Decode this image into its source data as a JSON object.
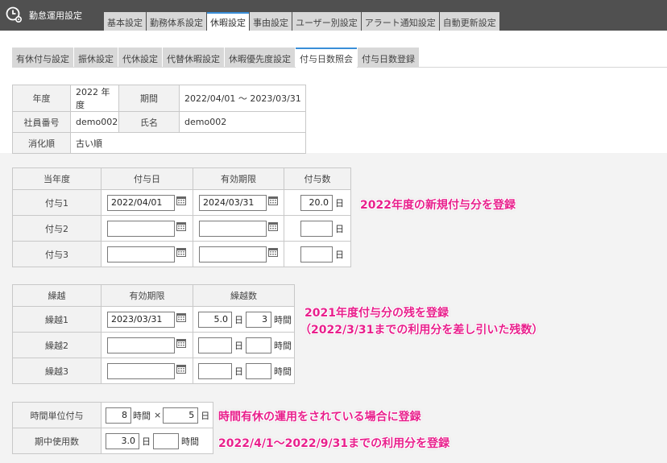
{
  "app": {
    "title": "勤怠運用設定",
    "icon": "clock-gear-icon"
  },
  "main_tabs": [
    "基本設定",
    "勤務体系設定",
    "休暇設定",
    "事由設定",
    "ユーザー別設定",
    "アラート通知設定",
    "自動更新設定"
  ],
  "main_tab_active": 2,
  "sub_tabs": [
    "有休付与設定",
    "振休設定",
    "代休設定",
    "代替休暇設定",
    "休暇優先度設定",
    "付与日数照会",
    "付与日数登録"
  ],
  "sub_tab_active": 5,
  "info": {
    "year_label": "年度",
    "year_value": "2022 年度",
    "period_label": "期間",
    "period_value": "2022/04/01 ～ 2023/03/31",
    "empno_label": "社員番号",
    "empno_value": "demo002",
    "name_label": "氏名",
    "name_value": "demo002",
    "order_label": "消化順",
    "order_value": "古い順"
  },
  "grant": {
    "headers": [
      "当年度",
      "付与日",
      "有効期限",
      "付与数"
    ],
    "unit": "日",
    "rows": [
      {
        "label": "付与1",
        "date": "2022/04/01",
        "expiry": "2024/03/31",
        "count": "20.0"
      },
      {
        "label": "付与2",
        "date": "",
        "expiry": "",
        "count": ""
      },
      {
        "label": "付与3",
        "date": "",
        "expiry": "",
        "count": ""
      }
    ]
  },
  "carry": {
    "headers": [
      "繰越",
      "有効期限",
      "繰越数"
    ],
    "day_unit": "日",
    "hour_unit": "時間",
    "rows": [
      {
        "label": "繰越1",
        "expiry": "2023/03/31",
        "days": "5.0",
        "hours": "3"
      },
      {
        "label": "繰越2",
        "expiry": "",
        "days": "",
        "hours": ""
      },
      {
        "label": "繰越3",
        "expiry": "",
        "days": "",
        "hours": ""
      }
    ]
  },
  "hourly": {
    "unit_label": "時間単位付与",
    "hours": "8",
    "hours_unit": "時間",
    "times": "×",
    "days": "5",
    "days_unit": "日",
    "used_label": "期中使用数",
    "used_days": "3.0",
    "used_days_unit": "日",
    "used_hours": "",
    "used_hours_unit": "時間"
  },
  "notes": {
    "grant": "2022年度の新規付与分を登録",
    "carry_1": "2021年度付与分の残を登録",
    "carry_2": "（2022/3/31までの利用分を差し引いた残数）",
    "hourly": "時間有休の運用をされている場合に登録",
    "used": "2022/4/1～2022/9/31までの利用分を登録"
  },
  "colors": {
    "topbar": "#505050",
    "active_tab_accent": "#3a8fd8",
    "note": "#e8208c"
  }
}
